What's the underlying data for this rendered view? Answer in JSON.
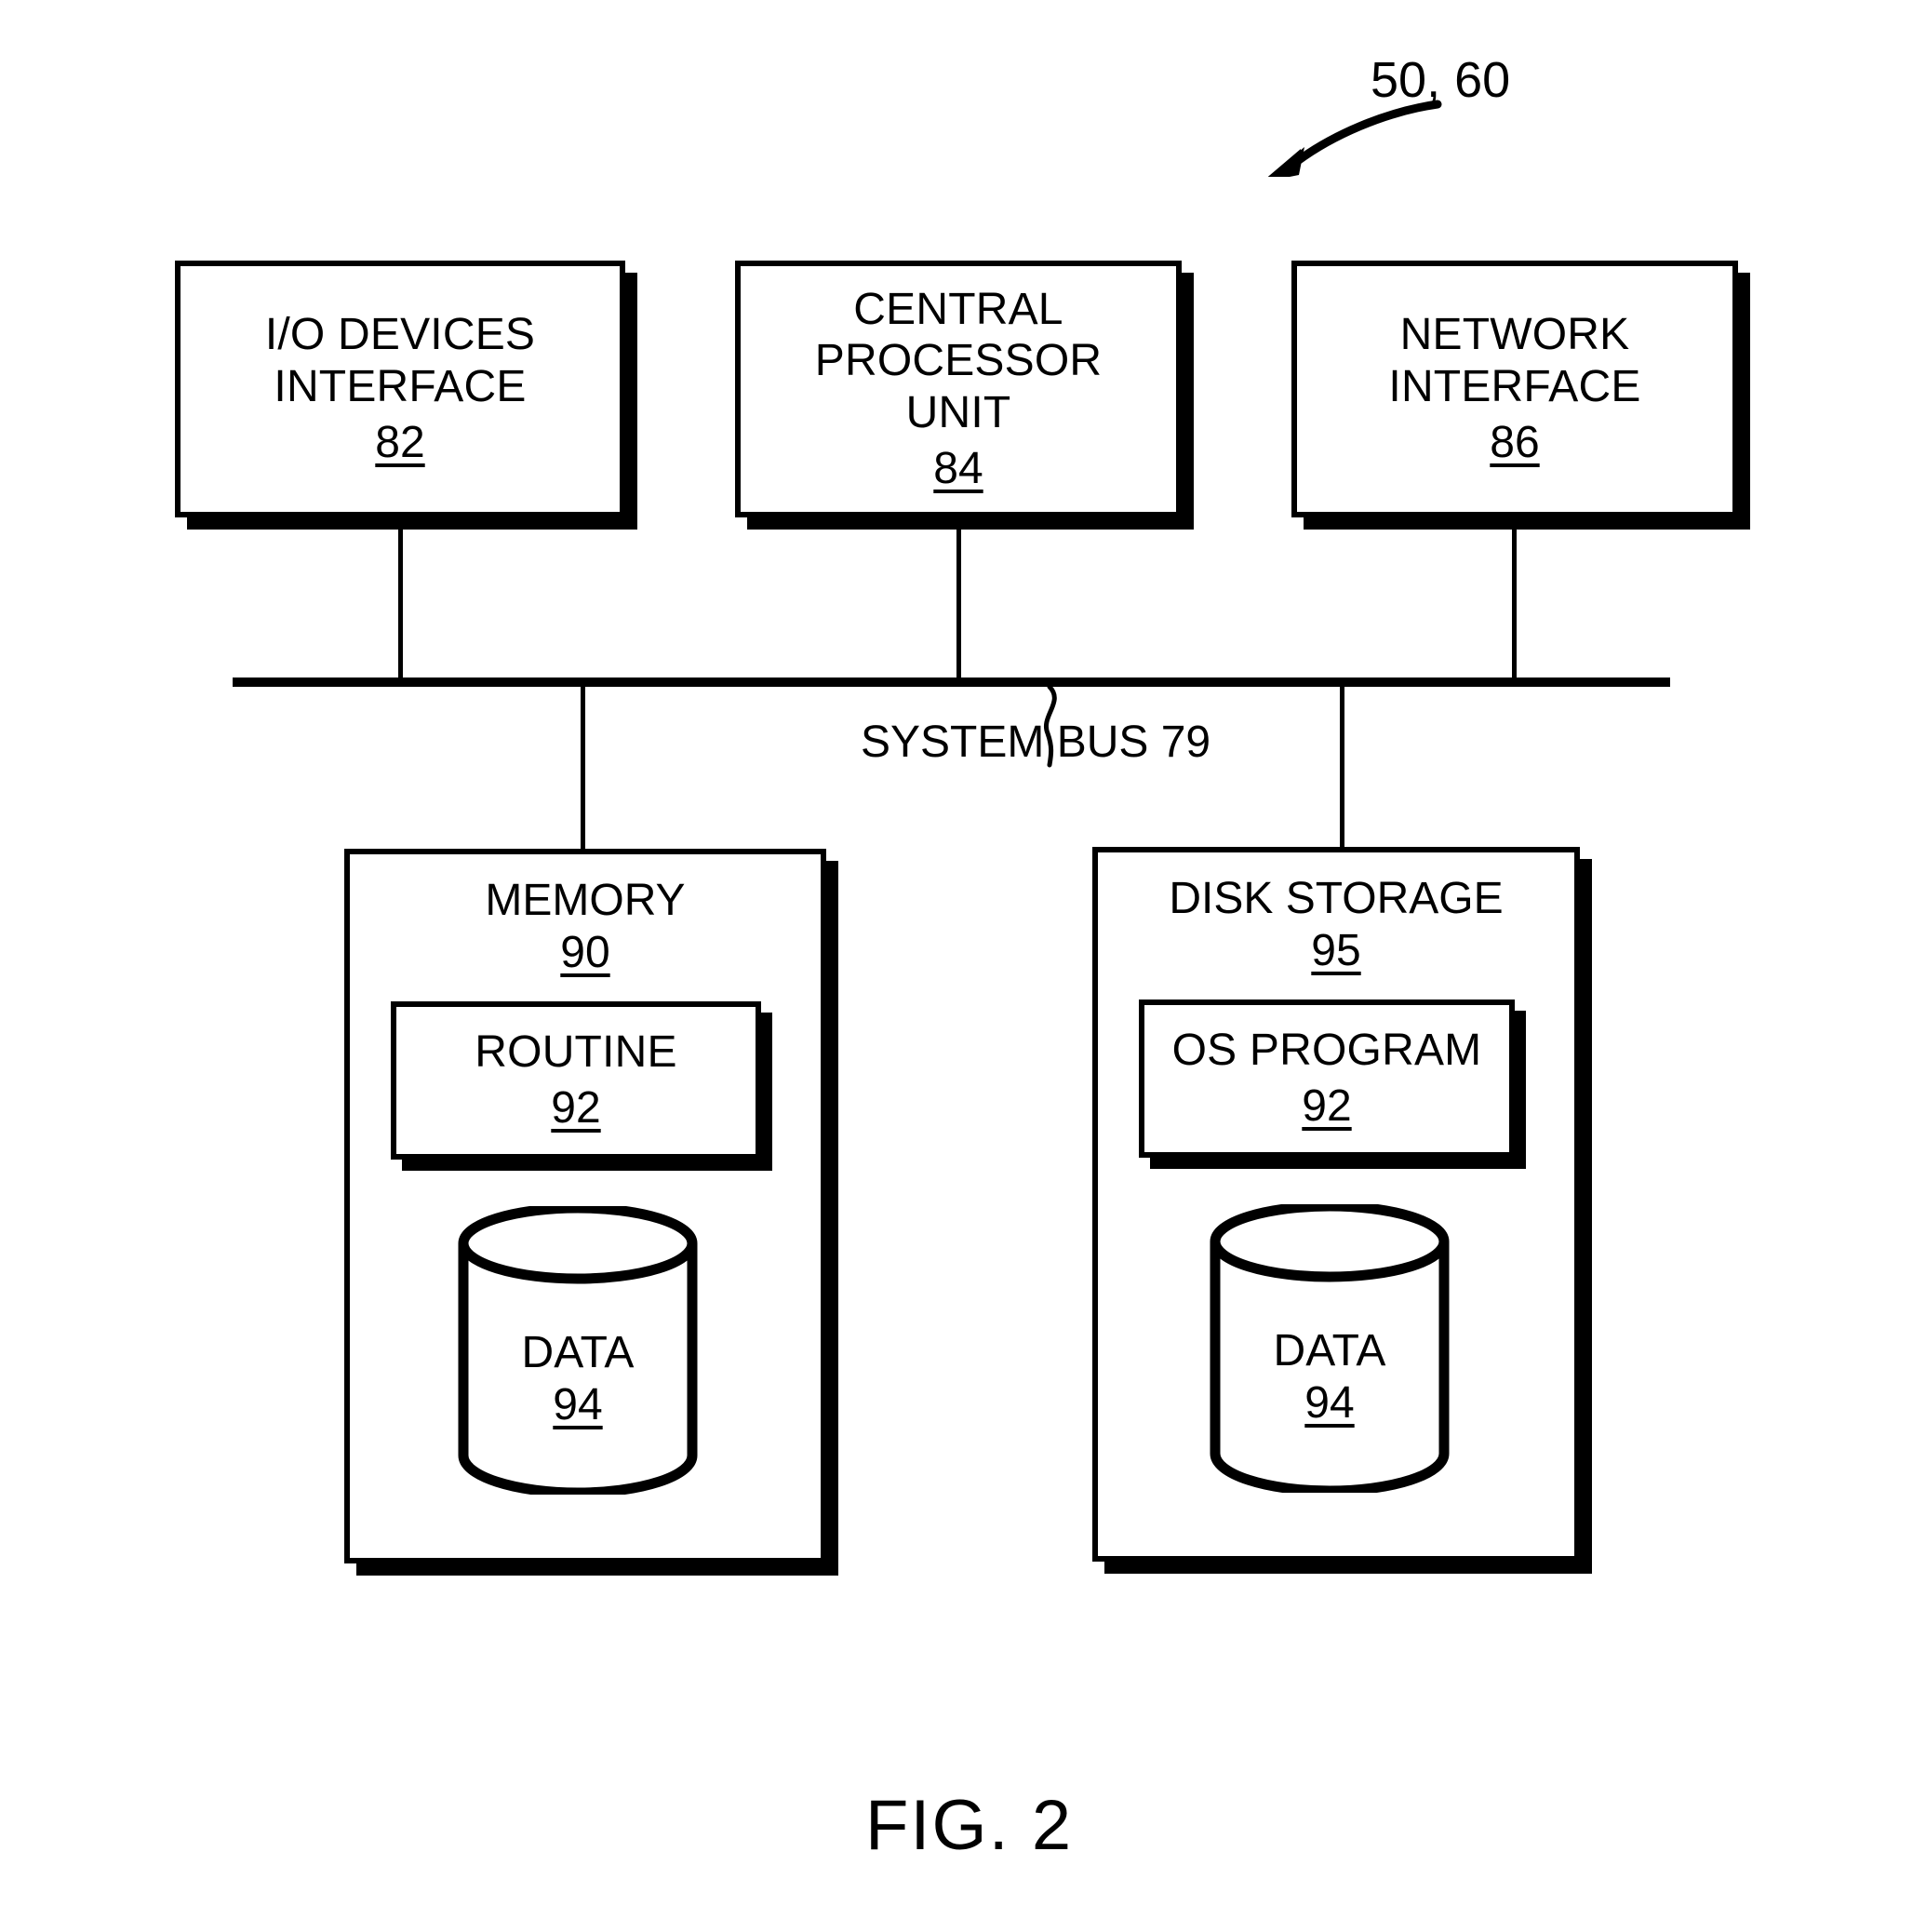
{
  "figure": {
    "caption": "FIG. 2",
    "callout": "50, 60"
  },
  "bus": {
    "label": "SYSTEM BUS 79"
  },
  "top_boxes": [
    {
      "title": "I/O DEVICES\nINTERFACE",
      "ref": "82",
      "name": "io-devices-interface"
    },
    {
      "title": "CENTRAL\nPROCESSOR\nUNIT",
      "ref": "84",
      "name": "central-processor-unit"
    },
    {
      "title": "NETWORK\nINTERFACE",
      "ref": "86",
      "name": "network-interface"
    }
  ],
  "memory": {
    "title": "MEMORY",
    "ref": "90",
    "inner": {
      "title": "ROUTINE",
      "ref": "92"
    },
    "store": {
      "title": "DATA",
      "ref": "94"
    }
  },
  "disk": {
    "title": "DISK STORAGE",
    "ref": "95",
    "inner": {
      "title": "OS PROGRAM",
      "ref": "92"
    },
    "store": {
      "title": "DATA",
      "ref": "94"
    }
  },
  "colors": {
    "ink": "#000000",
    "paper": "#ffffff"
  },
  "icons": {
    "callout_arrow": "curved-arrow-icon",
    "bus_leader": "squiggle-leader-icon",
    "cylinder": "database-cylinder-icon"
  }
}
